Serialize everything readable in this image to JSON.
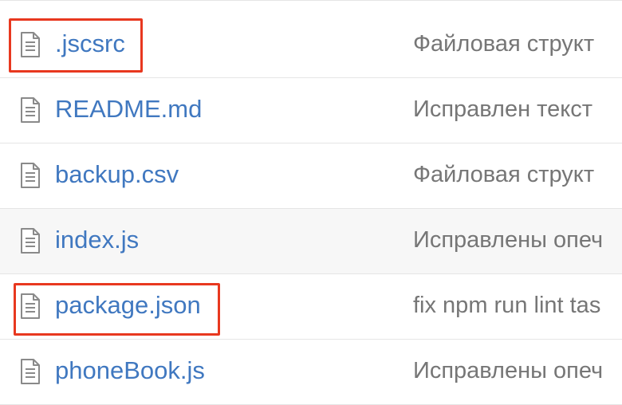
{
  "files": [
    {
      "name": ".jscsrc",
      "commit_message": "Файловая структ",
      "icon": "file-text-icon",
      "highlighted": true
    },
    {
      "name": "README.md",
      "commit_message": "Исправлен текст",
      "icon": "file-text-icon",
      "highlighted": false
    },
    {
      "name": "backup.csv",
      "commit_message": "Файловая структ",
      "icon": "file-text-icon",
      "highlighted": false
    },
    {
      "name": "index.js",
      "commit_message": "Исправлены опеч",
      "icon": "file-text-icon",
      "highlighted": false,
      "hovered": true
    },
    {
      "name": "package.json",
      "commit_message": "fix npm run lint tas",
      "icon": "file-text-icon",
      "highlighted": true
    },
    {
      "name": "phoneBook.js",
      "commit_message": "Исправлены опеч",
      "icon": "file-text-icon",
      "highlighted": false
    }
  ],
  "colors": {
    "link": "#4078c0",
    "commit_text": "#767676",
    "highlight": "#e8381f",
    "row_border": "#e5e5e5",
    "hover_row": "#f7f7f7"
  }
}
